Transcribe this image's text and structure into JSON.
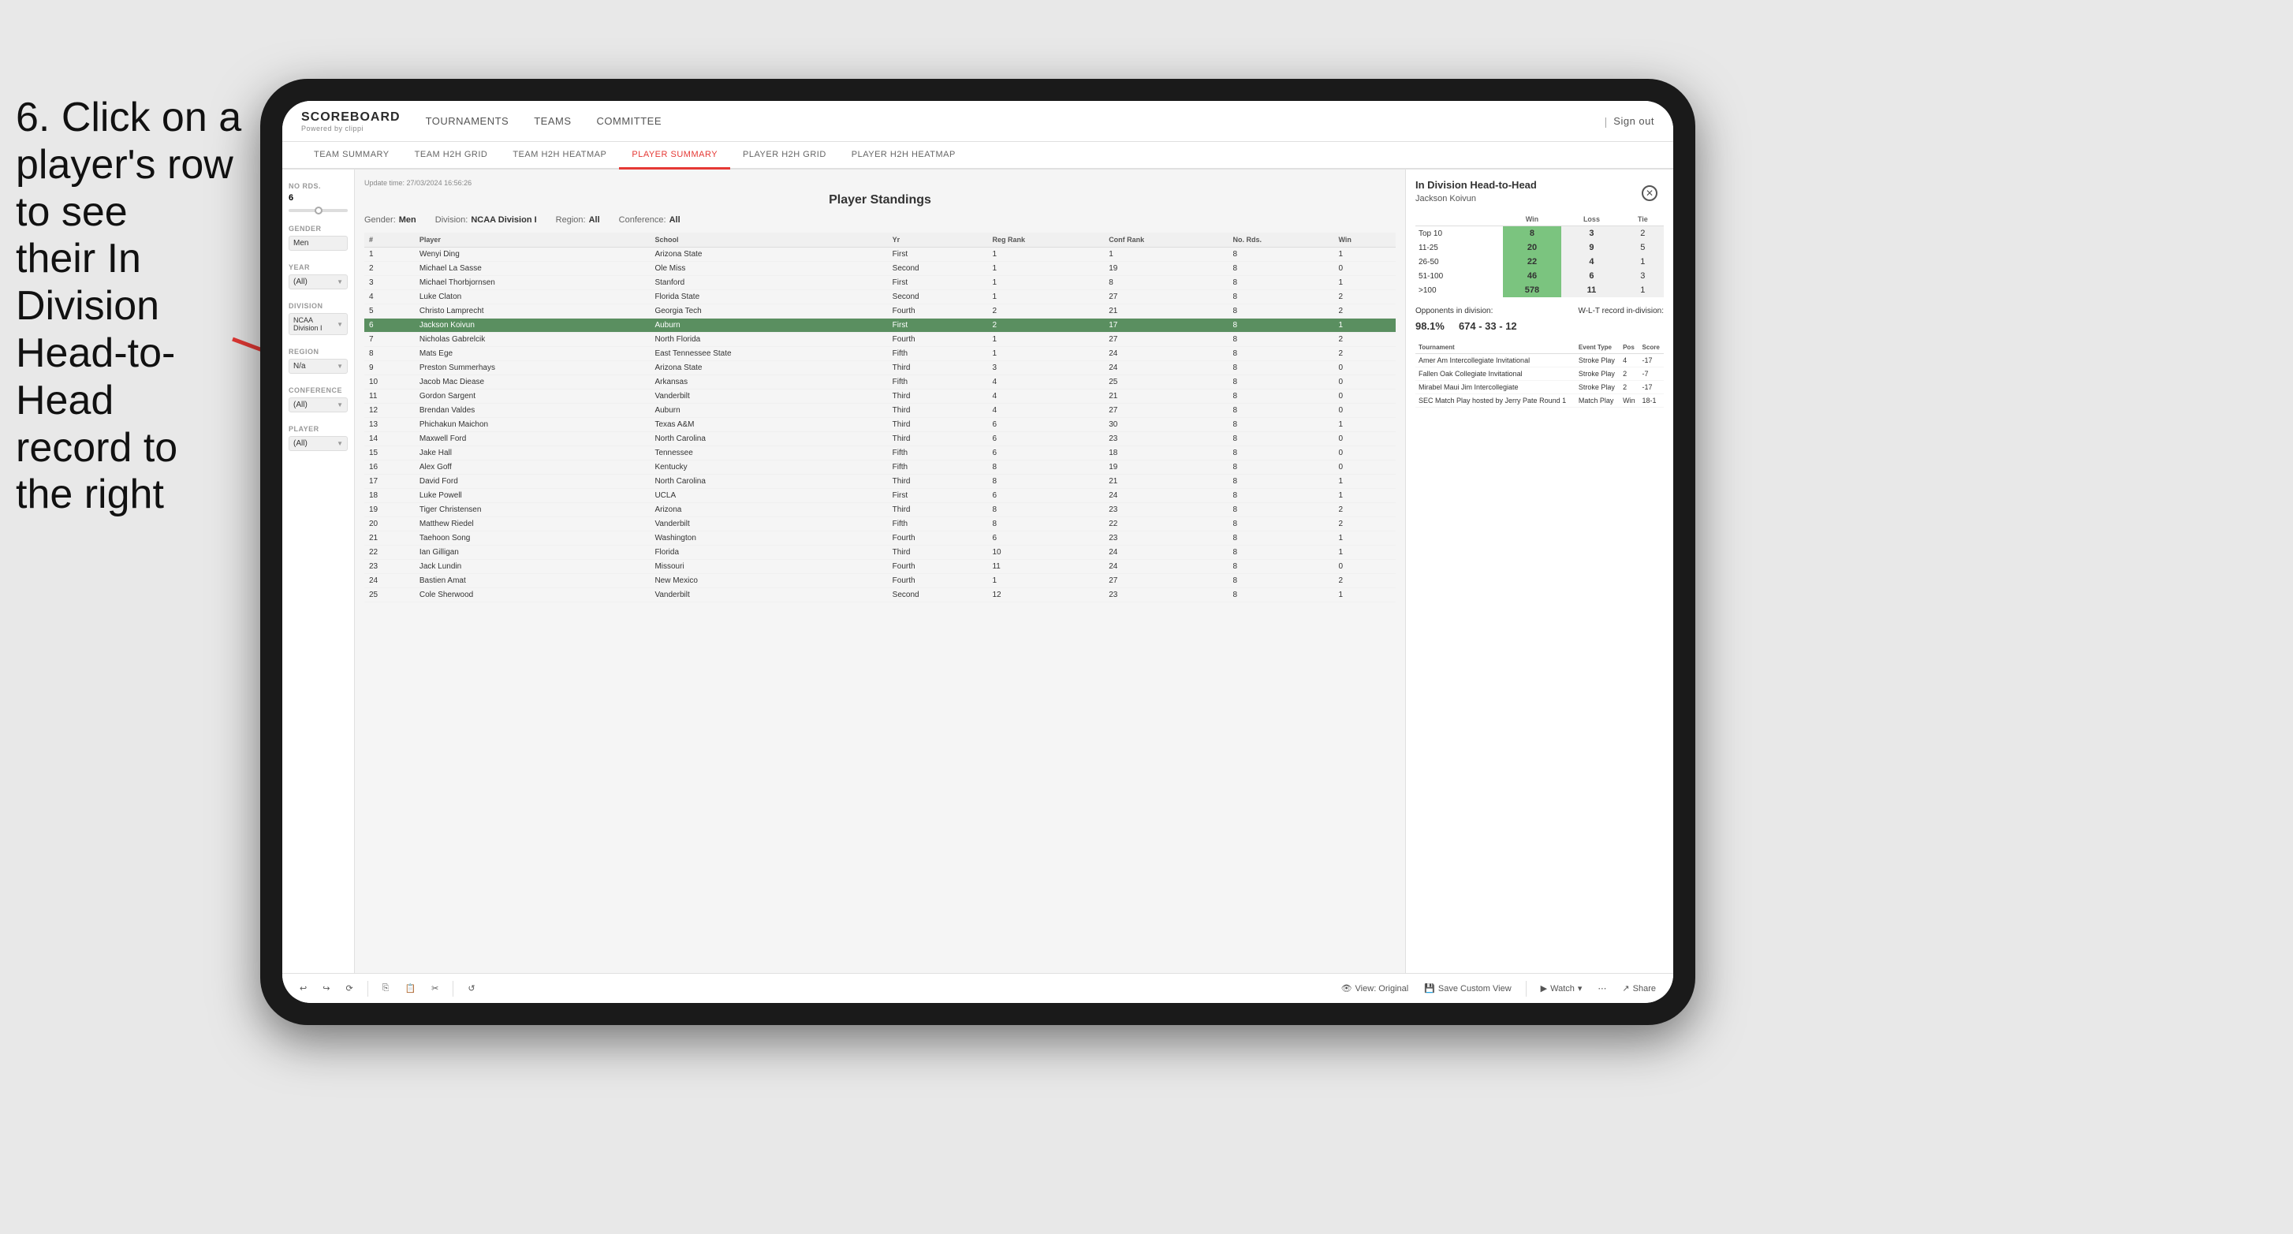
{
  "instruction": {
    "line1": "6. Click on a",
    "line2": "player's row to see",
    "line3": "their In Division",
    "line4": "Head-to-Head",
    "line5": "record to the right"
  },
  "app": {
    "logo_title": "SCOREBOARD",
    "logo_sub": "Powered by clippi",
    "nav_items": [
      "TOURNAMENTS",
      "TEAMS",
      "COMMITTEE"
    ],
    "sign_out": "Sign out",
    "sub_nav": [
      "TEAM SUMMARY",
      "TEAM H2H GRID",
      "TEAM H2H HEATMAP",
      "PLAYER SUMMARY",
      "PLAYER H2H GRID",
      "PLAYER H2H HEATMAP"
    ],
    "active_sub_nav": "PLAYER SUMMARY"
  },
  "sidebar": {
    "no_rds_label": "No Rds.",
    "no_rds_value": "6",
    "gender_label": "Gender",
    "gender_value": "Men",
    "year_label": "Year",
    "year_value": "(All)",
    "division_label": "Division",
    "division_value": "NCAA Division I",
    "region_label": "Region",
    "region_value": "N/a",
    "conference_label": "Conference",
    "conference_value": "(All)",
    "player_label": "Player",
    "player_value": "(All)"
  },
  "main": {
    "update_time": "Update time:\n27/03/2024 16:56:26",
    "panel_title": "Player Standings",
    "gender": "Men",
    "division": "NCAA Division I",
    "region": "All",
    "conference": "All",
    "table_headers": [
      "#",
      "Player",
      "School",
      "Yr",
      "Reg Rank",
      "Conf Rank",
      "No. Rds.",
      "Win"
    ],
    "players": [
      {
        "num": 1,
        "name": "Wenyi Ding",
        "school": "Arizona State",
        "yr": "First",
        "reg": 1,
        "conf": 1,
        "rds": 8,
        "win": 1,
        "selected": false
      },
      {
        "num": 2,
        "name": "Michael La Sasse",
        "school": "Ole Miss",
        "yr": "Second",
        "reg": 1,
        "conf": 19,
        "rds": 8,
        "win": 0,
        "selected": false
      },
      {
        "num": 3,
        "name": "Michael Thorbjornsen",
        "school": "Stanford",
        "yr": "First",
        "reg": 1,
        "conf": 8,
        "rds": 8,
        "win": 1,
        "selected": false
      },
      {
        "num": 4,
        "name": "Luke Claton",
        "school": "Florida State",
        "yr": "Second",
        "reg": 1,
        "conf": 27,
        "rds": 8,
        "win": 2,
        "selected": false
      },
      {
        "num": 5,
        "name": "Christo Lamprecht",
        "school": "Georgia Tech",
        "yr": "Fourth",
        "reg": 2,
        "conf": 21,
        "rds": 8,
        "win": 2,
        "selected": false
      },
      {
        "num": 6,
        "name": "Jackson Koivun",
        "school": "Auburn",
        "yr": "First",
        "reg": 2,
        "conf": 17,
        "rds": 8,
        "win": 1,
        "selected": true
      },
      {
        "num": 7,
        "name": "Nicholas Gabrelcik",
        "school": "North Florida",
        "yr": "Fourth",
        "reg": 1,
        "conf": 27,
        "rds": 8,
        "win": 2,
        "selected": false
      },
      {
        "num": 8,
        "name": "Mats Ege",
        "school": "East Tennessee State",
        "yr": "Fifth",
        "reg": 1,
        "conf": 24,
        "rds": 8,
        "win": 2,
        "selected": false
      },
      {
        "num": 9,
        "name": "Preston Summerhays",
        "school": "Arizona State",
        "yr": "Third",
        "reg": 3,
        "conf": 24,
        "rds": 8,
        "win": 0,
        "selected": false
      },
      {
        "num": 10,
        "name": "Jacob Mac Diease",
        "school": "Arkansas",
        "yr": "Fifth",
        "reg": 4,
        "conf": 25,
        "rds": 8,
        "win": 0,
        "selected": false
      },
      {
        "num": 11,
        "name": "Gordon Sargent",
        "school": "Vanderbilt",
        "yr": "Third",
        "reg": 4,
        "conf": 21,
        "rds": 8,
        "win": 0,
        "selected": false
      },
      {
        "num": 12,
        "name": "Brendan Valdes",
        "school": "Auburn",
        "yr": "Third",
        "reg": 4,
        "conf": 27,
        "rds": 8,
        "win": 0,
        "selected": false
      },
      {
        "num": 13,
        "name": "Phichakun Maichon",
        "school": "Texas A&M",
        "yr": "Third",
        "reg": 6,
        "conf": 30,
        "rds": 8,
        "win": 1,
        "selected": false
      },
      {
        "num": 14,
        "name": "Maxwell Ford",
        "school": "North Carolina",
        "yr": "Third",
        "reg": 6,
        "conf": 23,
        "rds": 8,
        "win": 0,
        "selected": false
      },
      {
        "num": 15,
        "name": "Jake Hall",
        "school": "Tennessee",
        "yr": "Fifth",
        "reg": 6,
        "conf": 18,
        "rds": 8,
        "win": 0,
        "selected": false
      },
      {
        "num": 16,
        "name": "Alex Goff",
        "school": "Kentucky",
        "yr": "Fifth",
        "reg": 8,
        "conf": 19,
        "rds": 8,
        "win": 0,
        "selected": false
      },
      {
        "num": 17,
        "name": "David Ford",
        "school": "North Carolina",
        "yr": "Third",
        "reg": 8,
        "conf": 21,
        "rds": 8,
        "win": 1,
        "selected": false
      },
      {
        "num": 18,
        "name": "Luke Powell",
        "school": "UCLA",
        "yr": "First",
        "reg": 6,
        "conf": 24,
        "rds": 8,
        "win": 1,
        "selected": false
      },
      {
        "num": 19,
        "name": "Tiger Christensen",
        "school": "Arizona",
        "yr": "Third",
        "reg": 8,
        "conf": 23,
        "rds": 8,
        "win": 2,
        "selected": false
      },
      {
        "num": 20,
        "name": "Matthew Riedel",
        "school": "Vanderbilt",
        "yr": "Fifth",
        "reg": 8,
        "conf": 22,
        "rds": 8,
        "win": 2,
        "selected": false
      },
      {
        "num": 21,
        "name": "Taehoon Song",
        "school": "Washington",
        "yr": "Fourth",
        "reg": 6,
        "conf": 23,
        "rds": 8,
        "win": 1,
        "selected": false
      },
      {
        "num": 22,
        "name": "Ian Gilligan",
        "school": "Florida",
        "yr": "Third",
        "reg": 10,
        "conf": 24,
        "rds": 8,
        "win": 1,
        "selected": false
      },
      {
        "num": 23,
        "name": "Jack Lundin",
        "school": "Missouri",
        "yr": "Fourth",
        "reg": 11,
        "conf": 24,
        "rds": 8,
        "win": 0,
        "selected": false
      },
      {
        "num": 24,
        "name": "Bastien Amat",
        "school": "New Mexico",
        "yr": "Fourth",
        "reg": 1,
        "conf": 27,
        "rds": 8,
        "win": 2,
        "selected": false
      },
      {
        "num": 25,
        "name": "Cole Sherwood",
        "school": "Vanderbilt",
        "yr": "Second",
        "reg": 12,
        "conf": 23,
        "rds": 8,
        "win": 1,
        "selected": false
      }
    ]
  },
  "h2h": {
    "title": "In Division Head-to-Head",
    "player": "Jackson Koivun",
    "wlt_headers": [
      "",
      "Win",
      "Loss",
      "Tie"
    ],
    "wlt_rows": [
      {
        "range": "Top 10",
        "win": 8,
        "loss": 3,
        "tie": 2
      },
      {
        "range": "11-25",
        "win": 20,
        "loss": 9,
        "tie": 5
      },
      {
        "range": "26-50",
        "win": 22,
        "loss": 4,
        "tie": 1
      },
      {
        "range": "51-100",
        "win": 46,
        "loss": 6,
        "tie": 3
      },
      {
        "range": ">100",
        "win": 578,
        "loss": 11,
        "tie": 1
      }
    ],
    "opponents_label": "Opponents in division:",
    "wl_label": "W-L-T record in-division:",
    "pct": "98.1%",
    "record": "674 - 33 - 12",
    "tournament_headers": [
      "Tournament",
      "Event Type",
      "Pos",
      "Score"
    ],
    "tournaments": [
      {
        "name": "Amer Am Intercollegiate Invitational",
        "type": "Stroke Play",
        "pos": 4,
        "score": "-17"
      },
      {
        "name": "Fallen Oak Collegiate Invitational",
        "type": "Stroke Play",
        "pos": 2,
        "score": "-7"
      },
      {
        "name": "Mirabel Maui Jim Intercollegiate",
        "type": "Stroke Play",
        "pos": 2,
        "score": "-17"
      },
      {
        "name": "SEC Match Play hosted by Jerry Pate Round 1",
        "type": "Match Play",
        "pos": "Win",
        "score": "18-1"
      }
    ]
  },
  "toolbar": {
    "view_original": "View: Original",
    "save_custom": "Save Custom View",
    "watch": "Watch",
    "share": "Share"
  }
}
